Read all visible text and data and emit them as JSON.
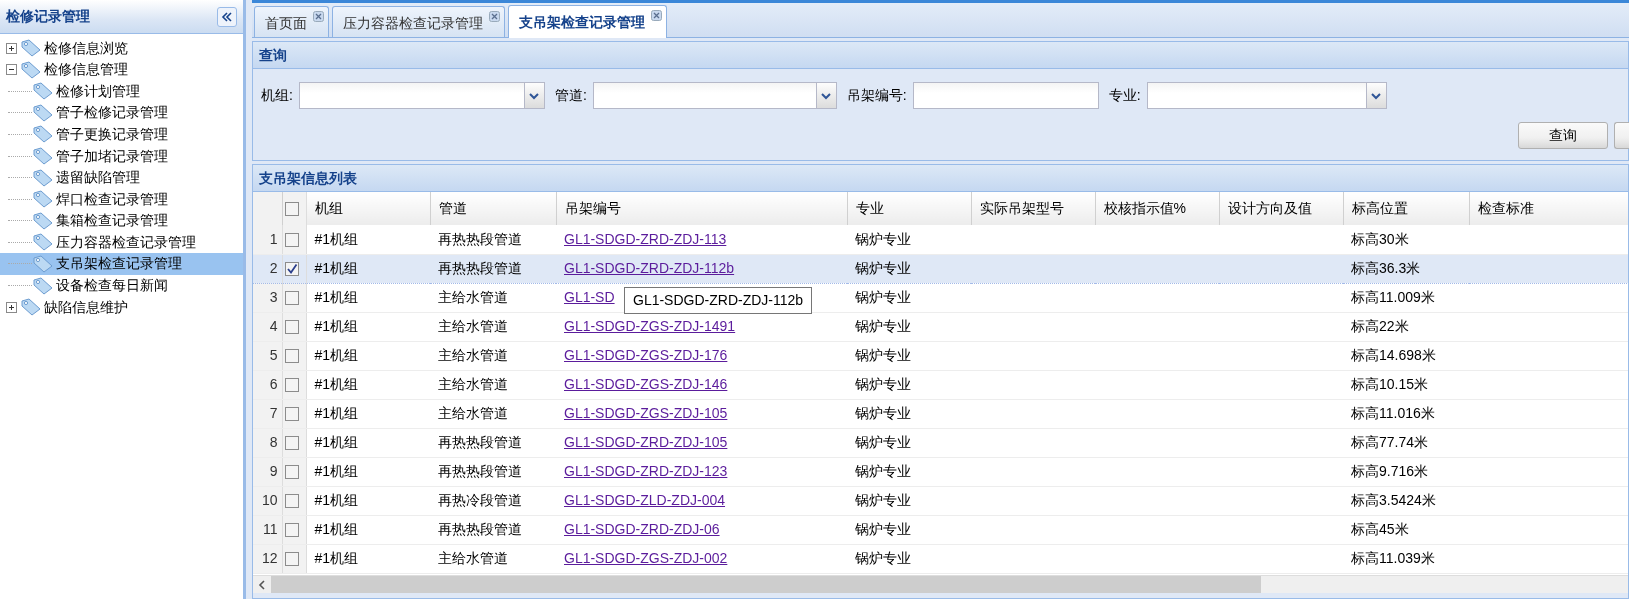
{
  "sidebar": {
    "title": "检修记录管理",
    "items": [
      {
        "label": "检修信息浏览",
        "expanded": false,
        "selected": false
      },
      {
        "label": "检修信息管理",
        "expanded": true,
        "selected": false,
        "children": [
          {
            "label": "检修计划管理",
            "selected": false
          },
          {
            "label": "管子检修记录管理",
            "selected": false
          },
          {
            "label": "管子更换记录管理",
            "selected": false
          },
          {
            "label": "管子加堵记录管理",
            "selected": false
          },
          {
            "label": "遗留缺陷管理",
            "selected": false
          },
          {
            "label": "焊口检查记录管理",
            "selected": false
          },
          {
            "label": "集箱检查记录管理",
            "selected": false
          },
          {
            "label": "压力容器检查记录管理",
            "selected": false
          },
          {
            "label": "支吊架检查记录管理",
            "selected": true
          },
          {
            "label": "设备检查每日新闻",
            "selected": false
          }
        ]
      },
      {
        "label": "缺陷信息维护",
        "expanded": false,
        "selected": false
      }
    ]
  },
  "tabs": [
    {
      "label": "首页面",
      "selected": false
    },
    {
      "label": "压力容器检查记录管理",
      "selected": false
    },
    {
      "label": "支吊架检查记录管理",
      "selected": true
    }
  ],
  "query": {
    "title": "查询",
    "fields": [
      {
        "label": "机组:",
        "kind": "combo"
      },
      {
        "label": "管道:",
        "kind": "combo"
      },
      {
        "label": "吊架编号:",
        "kind": "text"
      },
      {
        "label": "专业:",
        "kind": "combo"
      }
    ],
    "buttons": [
      "查询"
    ]
  },
  "grid": {
    "title": "支吊架信息列表",
    "columns": [
      "机组",
      "管道",
      "吊架编号",
      "专业",
      "实际吊架型号",
      "校核指示值%",
      "设计方向及值",
      "标高位置",
      "检查标准"
    ],
    "rows": [
      {
        "number": "1",
        "checked": false,
        "selected": false,
        "unit": "#1机组",
        "pipe": "再热热段管道",
        "hanger_id": "GL1-SDGD-ZRD-ZDJ-113",
        "specialty": "锅炉专业",
        "elevation": "标高30米"
      },
      {
        "number": "2",
        "checked": true,
        "selected": true,
        "unit": "#1机组",
        "pipe": "再热热段管道",
        "hanger_id": "GL1-SDGD-ZRD-ZDJ-112b",
        "specialty": "锅炉专业",
        "elevation": "标高36.3米"
      },
      {
        "number": "3",
        "checked": false,
        "selected": false,
        "unit": "#1机组",
        "pipe": "主给水管道",
        "hanger_id": "GL1-SD",
        "has_tooltip": true,
        "specialty": "锅炉专业",
        "elevation": "标高11.009米"
      },
      {
        "number": "4",
        "checked": false,
        "selected": false,
        "unit": "#1机组",
        "pipe": "主给水管道",
        "hanger_id": "GL1-SDGD-ZGS-ZDJ-1491",
        "specialty": "锅炉专业",
        "elevation": "标高22米"
      },
      {
        "number": "5",
        "checked": false,
        "selected": false,
        "unit": "#1机组",
        "pipe": "主给水管道",
        "hanger_id": "GL1-SDGD-ZGS-ZDJ-176",
        "specialty": "锅炉专业",
        "elevation": "标高14.698米"
      },
      {
        "number": "6",
        "checked": false,
        "selected": false,
        "unit": "#1机组",
        "pipe": "主给水管道",
        "hanger_id": "GL1-SDGD-ZGS-ZDJ-146",
        "specialty": "锅炉专业",
        "elevation": "标高10.15米"
      },
      {
        "number": "7",
        "checked": false,
        "selected": false,
        "unit": "#1机组",
        "pipe": "主给水管道",
        "hanger_id": "GL1-SDGD-ZGS-ZDJ-105",
        "specialty": "锅炉专业",
        "elevation": "标高11.016米"
      },
      {
        "number": "8",
        "checked": false,
        "selected": false,
        "unit": "#1机组",
        "pipe": "再热热段管道",
        "hanger_id": "GL1-SDGD-ZRD-ZDJ-105",
        "specialty": "锅炉专业",
        "elevation": "标高77.74米"
      },
      {
        "number": "9",
        "checked": false,
        "selected": false,
        "unit": "#1机组",
        "pipe": "再热热段管道",
        "hanger_id": "GL1-SDGD-ZRD-ZDJ-123",
        "specialty": "锅炉专业",
        "elevation": "标高9.716米"
      },
      {
        "number": "10",
        "checked": false,
        "selected": false,
        "unit": "#1机组",
        "pipe": "再热冷段管道",
        "hanger_id": "GL1-SDGD-ZLD-ZDJ-004",
        "specialty": "锅炉专业",
        "elevation": "标高3.5424米"
      },
      {
        "number": "11",
        "checked": false,
        "selected": false,
        "unit": "#1机组",
        "pipe": "再热热段管道",
        "hanger_id": "GL1-SDGD-ZRD-ZDJ-06",
        "specialty": "锅炉专业",
        "elevation": "标高45米"
      },
      {
        "number": "12",
        "checked": false,
        "selected": false,
        "unit": "#1机组",
        "pipe": "主给水管道",
        "hanger_id": "GL1-SDGD-ZGS-ZDJ-002",
        "specialty": "锅炉专业",
        "elevation": "标高11.039米"
      }
    ],
    "select_all_checked": false,
    "tooltip": {
      "text": "GL1-SDGD-ZRD-ZDJ-112b"
    }
  }
}
